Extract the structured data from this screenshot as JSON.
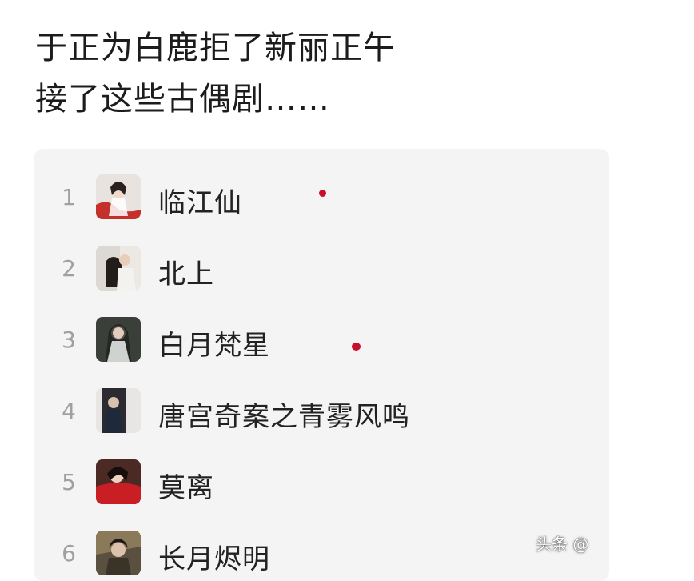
{
  "headline": {
    "line1": "于正为白鹿拒了新丽正午",
    "line2": "接了这些古偶剧……"
  },
  "list": {
    "items": [
      {
        "rank": "1",
        "title": "临江仙"
      },
      {
        "rank": "2",
        "title": "北上"
      },
      {
        "rank": "3",
        "title": "白月梵星"
      },
      {
        "rank": "4",
        "title": "唐宫奇案之青雾风鸣"
      },
      {
        "rank": "5",
        "title": "莫离"
      },
      {
        "rank": "6",
        "title": "长月烬明"
      }
    ]
  },
  "colors": {
    "card_background": "#f4f4f5",
    "rank_text": "#a0a0a0",
    "title_text": "#222222",
    "accent_dot": "#c8102e"
  },
  "watermark": {
    "text": "头条 @"
  }
}
